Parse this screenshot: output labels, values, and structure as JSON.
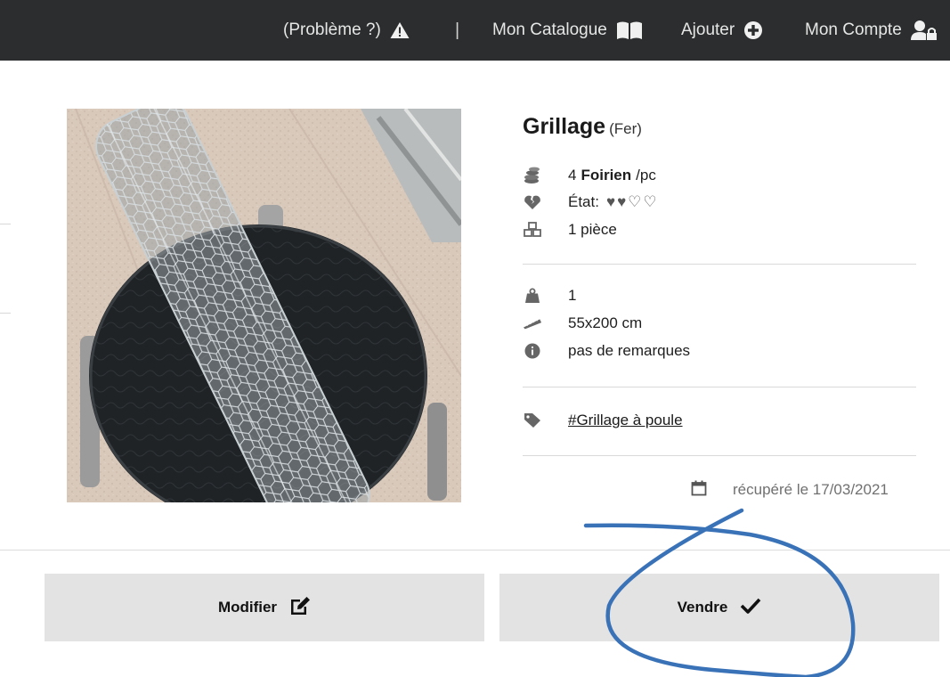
{
  "nav": {
    "problem_label": "(Problème ?)",
    "separator": "|",
    "catalogue_label": "Mon Catalogue",
    "add_label": "Ajouter",
    "account_label": "Mon Compte"
  },
  "product": {
    "name": "Grillage",
    "material": "(Fer)",
    "price_amount": "4",
    "price_currency": "Foirien",
    "price_unit": "/pc",
    "condition_label": "État:",
    "condition_rating": 2,
    "condition_max": 4,
    "quantity": "1 pièce",
    "weight": "1",
    "dimensions": "55x200 cm",
    "remarks": "pas de remarques",
    "tag": "#Grillage à poule",
    "recovered": "récupéré le 17/03/2021"
  },
  "actions": {
    "modify_label": "Modifier",
    "sell_label": "Vendre"
  },
  "colors": {
    "topbar": "#2b2d2e",
    "button_bg": "#e3e3e3",
    "annotation": "#3a72b8"
  },
  "icons": [
    "warning-icon",
    "book-icon",
    "plus-circle-icon",
    "user-lock-icon",
    "coins-icon",
    "heart-broken-icon",
    "cubes-icon",
    "weight-icon",
    "ruler-icon",
    "info-icon",
    "tag-icon",
    "calendar-icon",
    "edit-icon",
    "check-icon"
  ]
}
